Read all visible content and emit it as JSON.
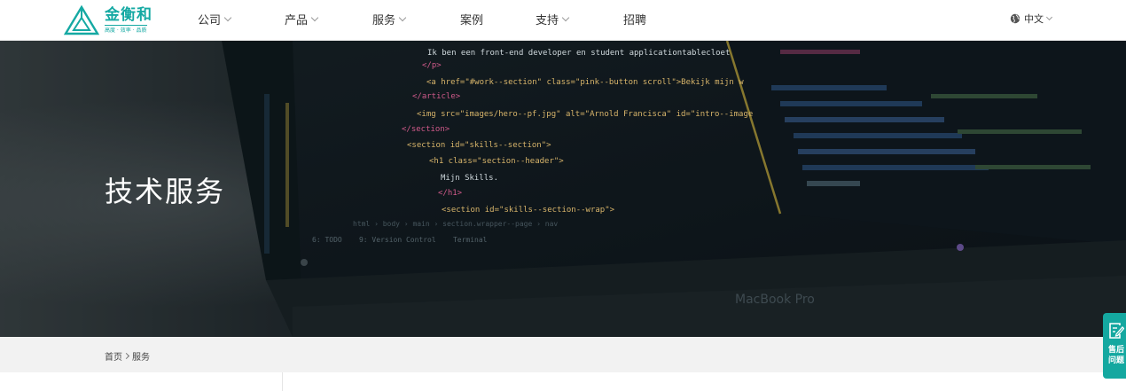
{
  "header": {
    "logo": {
      "name": "金衡和",
      "slogan": "高度 · 效率 · 品质"
    },
    "nav": [
      {
        "label": "公司",
        "dropdown": true
      },
      {
        "label": "产品",
        "dropdown": true
      },
      {
        "label": "服务",
        "dropdown": true
      },
      {
        "label": "案例",
        "dropdown": false
      },
      {
        "label": "支持",
        "dropdown": true
      },
      {
        "label": "招聘",
        "dropdown": false
      }
    ],
    "language": {
      "label": "中文",
      "icon": "globe-icon"
    }
  },
  "banner": {
    "title": "技术服务",
    "code_lines": [
      "Ik ben een front-end developer en student applicationtablecloet",
      "</p>",
      "<a href=\"#work--section\" class=\"pink--button scroll\">Bekijk mijn w",
      "</article>",
      "<img src=\"images/hero--pf.jpg\" alt=\"Arnold Francisca\" id=\"intro--image",
      "</section>",
      "<section id=\"skills--section\">",
      "<h1 class=\"section--header\">",
      "Mijn Skills.",
      "</h1>",
      "<section id=\"skills--section--wrap\">"
    ],
    "status_bar": [
      "html",
      "body",
      "main",
      "section.wrapper--page",
      "nav"
    ],
    "panel_tabs": [
      "6: TODO",
      "9: Version Control",
      "Terminal"
    ],
    "laptop_brand": "MacBook Pro"
  },
  "breadcrumb": {
    "items": [
      "首页",
      "服务"
    ]
  },
  "side_widget": {
    "label": "售后问题",
    "icon": "edit-note-icon"
  },
  "colors": {
    "brand": "#15a9a3",
    "widget": "#14a8a0"
  }
}
